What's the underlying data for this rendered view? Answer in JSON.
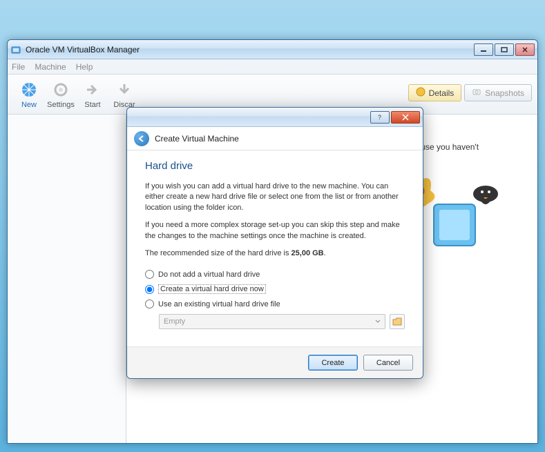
{
  "window": {
    "title": "Oracle VM VirtualBox Manager"
  },
  "menu": {
    "file": "File",
    "machine": "Machine",
    "help": "Help"
  },
  "toolbar": {
    "new": "New",
    "settings": "Settings",
    "start": "Start",
    "discard": "Discar"
  },
  "right_tabs": {
    "details": "Details",
    "snapshots": "Snapshots"
  },
  "welcome": {
    "fragment": "now because you haven't"
  },
  "dialog": {
    "title": "Create Virtual Machine",
    "heading": "Hard drive",
    "para1": "If you wish you can add a virtual hard drive to the new machine. You can either create a new hard drive file or select one from the list or from another location using the folder icon.",
    "para2": "If you need a more complex storage set-up you can skip this step and make the changes to the machine settings once the machine is created.",
    "para3_prefix": "The recommended size of the hard drive is ",
    "para3_size": "25,00 GB",
    "para3_suffix": ".",
    "options": {
      "none": "Do not add a virtual hard drive",
      "create": "Create a virtual hard drive now",
      "existing": "Use an existing virtual hard drive file"
    },
    "combo_value": "Empty",
    "buttons": {
      "create": "Create",
      "cancel": "Cancel"
    }
  }
}
